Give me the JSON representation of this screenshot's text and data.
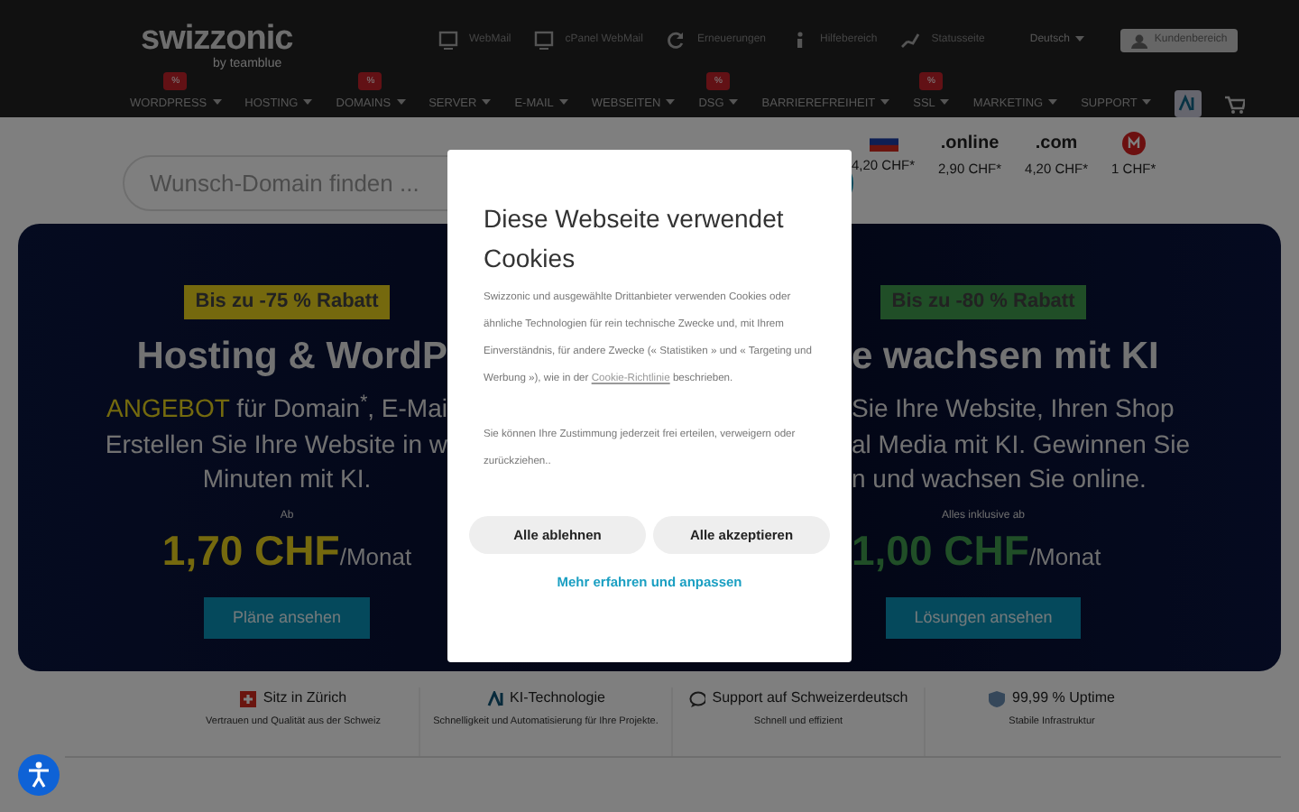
{
  "header": {
    "logo": "swizzonic",
    "logo_sub": "by teamblue",
    "top_links": [
      {
        "kind": "monitor",
        "label": "WebMail"
      },
      {
        "kind": "monitor",
        "label": "cPanel WebMail"
      },
      {
        "kind": "refresh",
        "label": "Erneuerungen"
      },
      {
        "kind": "info",
        "label": "Hilfebereich"
      },
      {
        "kind": "signal",
        "label": "Statusseite"
      }
    ],
    "language": "Deutsch",
    "account_button": "Kundenbereich",
    "menu": [
      {
        "label": "WORDPRESS",
        "badge": "%"
      },
      {
        "label": "HOSTING"
      },
      {
        "label": "DOMAINS",
        "badge": "%"
      },
      {
        "label": "SERVER"
      },
      {
        "label": "E-MAIL"
      },
      {
        "label": "WEBSEITEN"
      },
      {
        "label": "DSG",
        "badge": "%"
      },
      {
        "label": "BARRIEREFREIHEIT"
      },
      {
        "label": "SSL",
        "badge": "%"
      },
      {
        "label": "MARKETING"
      },
      {
        "label": "SUPPORT"
      }
    ]
  },
  "domain_search": {
    "placeholder": "Wunsch-Domain finden ...",
    "tlds": [
      {
        "kind": "flag",
        "price": "4,20 CHF*"
      },
      {
        "kind": "text",
        "name": ".online",
        "price": "2,90 CHF*"
      },
      {
        "kind": "text",
        "name": ".com",
        "price": "4,20 CHF*"
      },
      {
        "kind": "logo",
        "price": "1 CHF*"
      }
    ]
  },
  "hero": {
    "slides": [
      {
        "badge": "Bis zu -75 % Rabatt",
        "color": "#75690e",
        "title": "Hosting & WordP",
        "lines": [
          {
            "highlight": "ANGEBOT",
            "text": " für Domain$^{*}$, E-Mai"
          },
          {
            "text": "Erstellen Sie Ihre Website in w"
          }
        ],
        "last_line": "Minuten mit KI.",
        "price_label": "Ab",
        "price": "1,70 CHF",
        "per": "/Monat",
        "button": "Pläne ansehen"
      },
      {
        "badge": "Bis zu -80 % Rabatt",
        "color": "#204e27",
        "title": "e wachsen mit KI",
        "lines": [
          {
            "text": "Sie Ihre Website, Ihren Shop"
          },
          {
            "text": "al Media mit KI. Gewinnen Sie"
          },
          {
            "text": "n und wachsen Sie online."
          }
        ],
        "price_label": "Alles inklusive ab",
        "price": "1,00 CHF",
        "per": "/Monat",
        "button": "Lösungen ansehen"
      }
    ]
  },
  "features": [
    {
      "kind": "swiss-flag",
      "title": "Sitz in Zürich",
      "text": "Vertrauen und Qualität aus der Schweiz"
    },
    {
      "kind": "ai",
      "title": "KI-Technologie",
      "text": "Schnelligkeit und Automatisierung für Ihre Projekte."
    },
    {
      "kind": "chat",
      "title": "Support auf Schweizerdeutsch",
      "text": "Schnell und effizient"
    },
    {
      "kind": "shield",
      "title": "99,99 % Uptime",
      "text": "Stabile Infrastruktur"
    }
  ],
  "cookie_dialog": {
    "title": "Diese Webseite verwendet Cookies",
    "text_before": "Swizzonic und ausgewählte Drittanbieter verwenden Cookies oder ähnliche Technologien für rein technische Zwecke und, mit Ihrem Einverständnis, für andere Zwecke (« Statistiken » und « Targeting und Werbung »), wie in der ",
    "link": "Cookie-Richtlinie",
    "text_after": " beschrieben.",
    "text_2": "Sie können Ihre Zustimmung jederzeit frei erteilen, verweigern oder zurückziehen..",
    "buttons": [
      "Alle ablehnen",
      "Alle akzeptieren"
    ],
    "more_link": "Mehr erfahren und anpassen"
  }
}
